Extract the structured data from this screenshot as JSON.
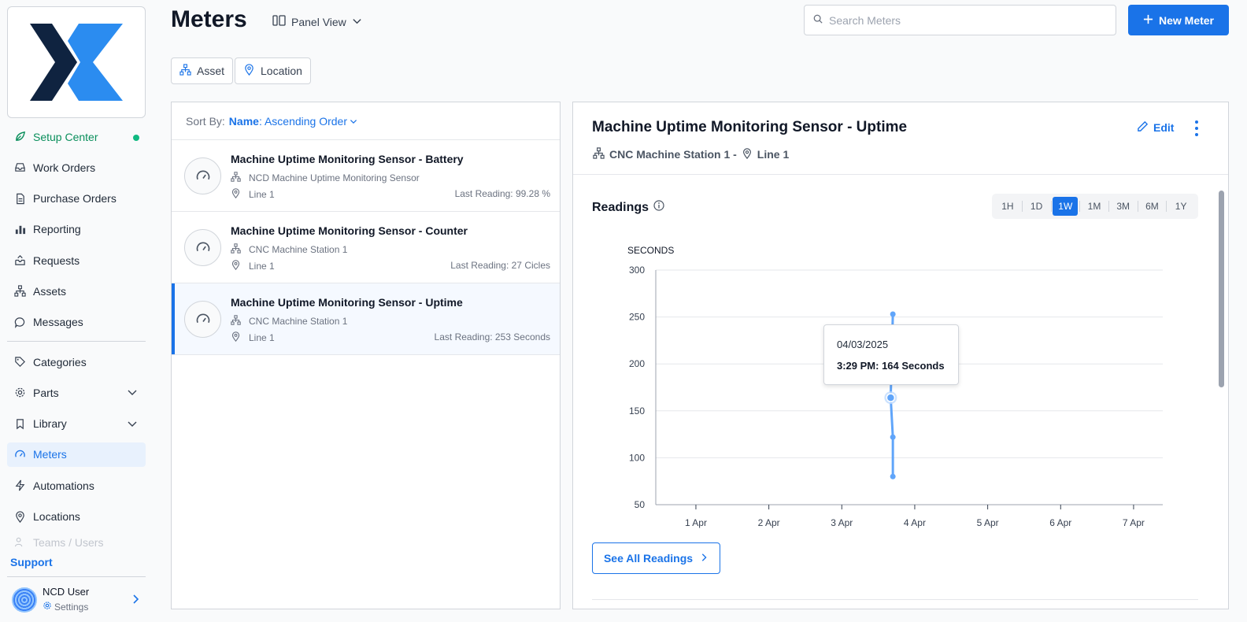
{
  "page": {
    "title": "Meters",
    "view_label": "Panel View"
  },
  "search": {
    "placeholder": "Search Meters",
    "value": ""
  },
  "actions": {
    "new_meter": "New Meter"
  },
  "filters": {
    "asset": "Asset",
    "location": "Location"
  },
  "sidebar": {
    "items": [
      {
        "label": "Setup Center",
        "icon": "leaf-icon"
      },
      {
        "label": "Work Orders",
        "icon": "inbox-icon"
      },
      {
        "label": "Purchase Orders",
        "icon": "document-icon"
      },
      {
        "label": "Reporting",
        "icon": "bar-chart-icon"
      },
      {
        "label": "Requests",
        "icon": "tray-icon"
      },
      {
        "label": "Assets",
        "icon": "hierarchy-icon"
      },
      {
        "label": "Messages",
        "icon": "chat-icon"
      },
      {
        "label": "Categories",
        "icon": "tag-icon"
      },
      {
        "label": "Parts",
        "icon": "gear-icon"
      },
      {
        "label": "Library",
        "icon": "bookmark-icon"
      },
      {
        "label": "Meters",
        "icon": "gauge-icon"
      },
      {
        "label": "Automations",
        "icon": "lightning-icon"
      },
      {
        "label": "Locations",
        "icon": "map-pin-icon"
      },
      {
        "label": "Teams / Users",
        "icon": "users-icon"
      }
    ],
    "support": "Support",
    "user": {
      "name": "NCD User",
      "settings": "Settings"
    }
  },
  "list": {
    "sort_prefix": "Sort By:",
    "sort_key": "Name",
    "sort_value": ": Ascending Order",
    "meters": [
      {
        "title": "Machine Uptime Monitoring Sensor - Battery",
        "asset": "NCD Machine Uptime Monitoring Sensor",
        "location": "Line 1",
        "last": "Last Reading: 99.28 %"
      },
      {
        "title": "Machine Uptime Monitoring Sensor - Counter",
        "asset": "CNC Machine Station 1",
        "location": "Line 1",
        "last": "Last Reading: 27 Cicles"
      },
      {
        "title": "Machine Uptime Monitoring Sensor - Uptime",
        "asset": "CNC Machine Station 1",
        "location": "Line 1",
        "last": "Last Reading: 253 Seconds"
      }
    ]
  },
  "detail": {
    "title": "Machine Uptime Monitoring Sensor - Uptime",
    "asset": "CNC Machine Station 1 -",
    "location": "Line 1",
    "edit": "Edit",
    "readings_title": "Readings",
    "ranges": [
      "1H",
      "1D",
      "1W",
      "1M",
      "3M",
      "6M",
      "1Y"
    ],
    "active_range": "1W",
    "see_all": "See All Readings",
    "tooltip": {
      "date": "04/03/2025",
      "value": "3:29 PM: 164 Seconds"
    }
  },
  "colors": {
    "accent": "#1a73e8",
    "line": "#60a5fa",
    "setup_green": "#0b8f5c"
  },
  "chart_data": {
    "type": "line",
    "ylabel": "SECONDS",
    "xlabel": "",
    "ylim": [
      50,
      300
    ],
    "yticks": [
      50,
      100,
      150,
      200,
      250,
      300
    ],
    "xticks": [
      "1 Apr",
      "2 Apr",
      "3 Apr",
      "4 Apr",
      "5 Apr",
      "6 Apr",
      "7 Apr"
    ],
    "xlim": [
      0.45,
      7.4
    ],
    "grid": true,
    "series": [
      {
        "points": [
          {
            "x": 3.7,
            "y": 253
          },
          {
            "x": 3.67,
            "y": 164
          },
          {
            "x": 3.7,
            "y": 122
          },
          {
            "x": 3.7,
            "y": 80
          }
        ]
      }
    ],
    "highlight_index": 1
  }
}
